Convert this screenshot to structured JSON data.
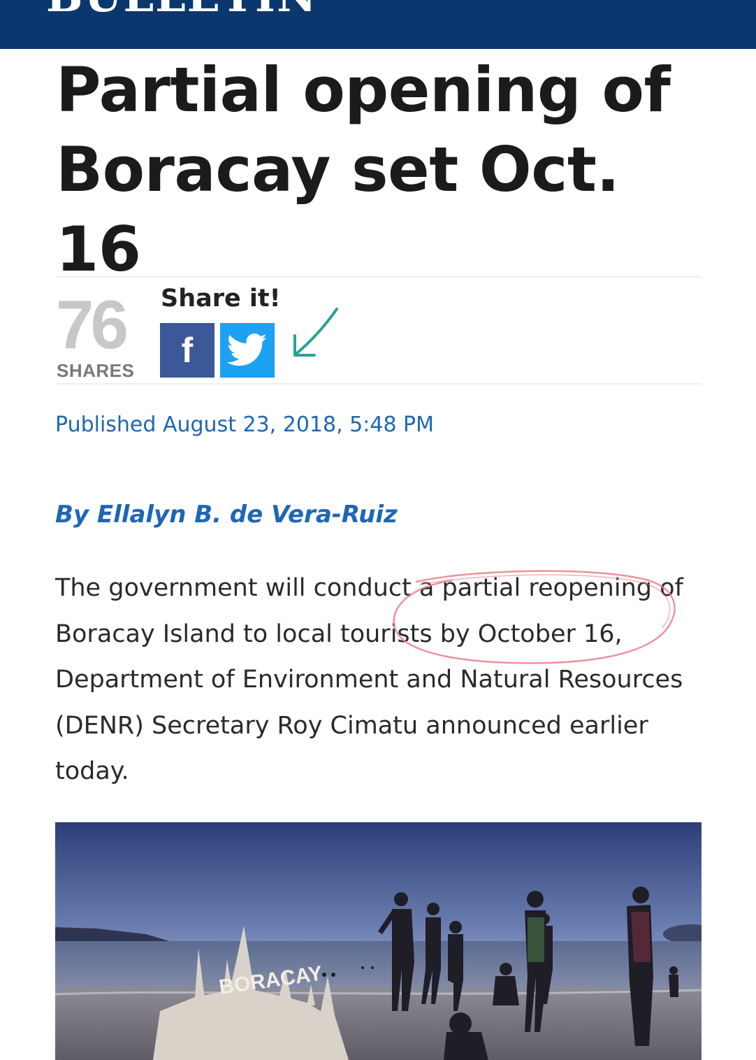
{
  "masthead": {
    "brand": "BULLETIN"
  },
  "article": {
    "title": "Partial opening of Boracay set Oct. 16",
    "published": "Published August 23, 2018, 5:48 PM",
    "byline": "By Ellalyn B. de Vera-Ruiz",
    "lead": "The government will conduct a partial reopening of Boracay Island to local tourists by October 16, Department of Environment and Natural Resources (DENR) Secretary Roy Cimatu announced earlier today."
  },
  "share": {
    "count": "76",
    "count_label": "SHARES",
    "heading": "Share it!",
    "facebook_glyph": "f",
    "buttons": [
      {
        "network": "facebook",
        "icon": "facebook-icon",
        "color": "#3b5998"
      },
      {
        "network": "twitter",
        "icon": "twitter-icon",
        "color": "#1da1f2"
      }
    ]
  },
  "annotations": {
    "arrow_color": "#2aa198",
    "circle_color": "#e8808a",
    "circled_text": "partial reopening of Boracay Island to local tourists by October 16"
  },
  "hero_image": {
    "description_icon": "beach-photo",
    "sand_text": "BORACAY"
  },
  "colors": {
    "header": "#0a376e",
    "link": "#1e67b4",
    "headline": "#1b1b1b"
  }
}
